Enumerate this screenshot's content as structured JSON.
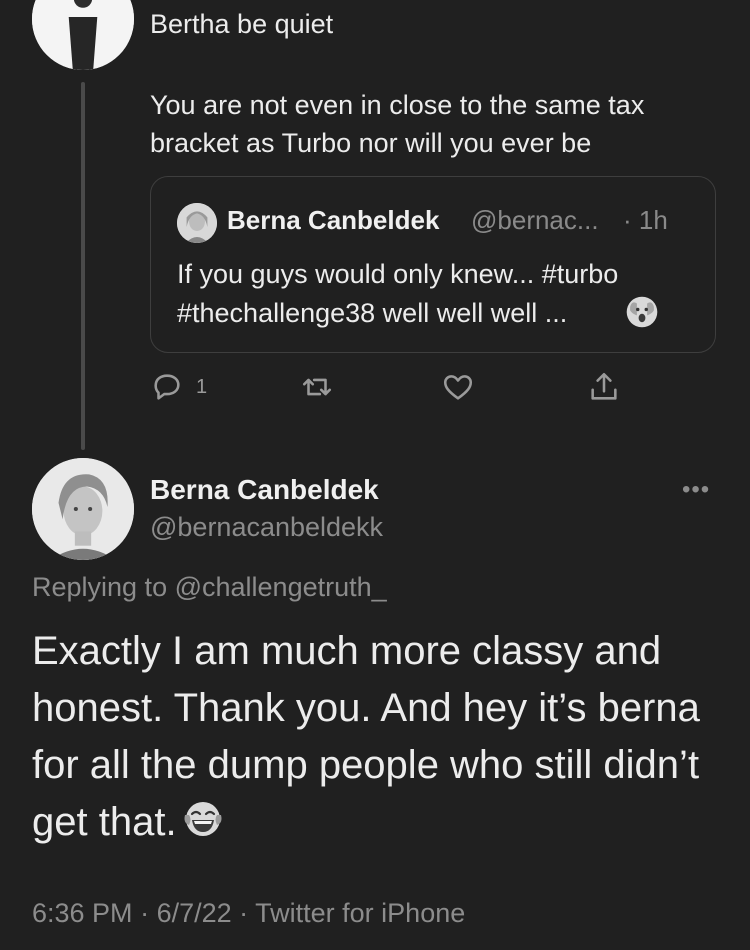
{
  "previous_tweet": {
    "line1": "Bertha be quiet",
    "body": "You are not even in close to the same tax bracket as Turbo nor will you ever be",
    "quote": {
      "name": "Berna Canbeldek",
      "handle": "@bernac...",
      "time": "· 1h",
      "text": "If you guys would only knew... #turbo #thechallenge38 well well well ...",
      "emoji": "shocked-face-emoji"
    },
    "actions": {
      "reply_count": "1",
      "retweet_icon": "retweet-icon",
      "like_icon": "heart-icon",
      "share_icon": "share-icon"
    }
  },
  "main_tweet": {
    "name": "Berna Canbeldek",
    "handle": "@bernacanbeldekk",
    "more": "•••",
    "replying_prefix": "Replying to ",
    "replying_to": "@challengetruth_",
    "text": "Exactly I am much more classy and honest. Thank you. And hey it’s berna for all the dump people who still didn’t get that.",
    "emoji": "laughing-tears-emoji",
    "time": "6:36 PM",
    "date": "6/7/22",
    "source": "Twitter for iPhone",
    "sep": " · "
  },
  "colors": {
    "background": "#202020",
    "text": "#ececec",
    "muted": "#8c8c8c",
    "border": "#3e3e3e"
  }
}
